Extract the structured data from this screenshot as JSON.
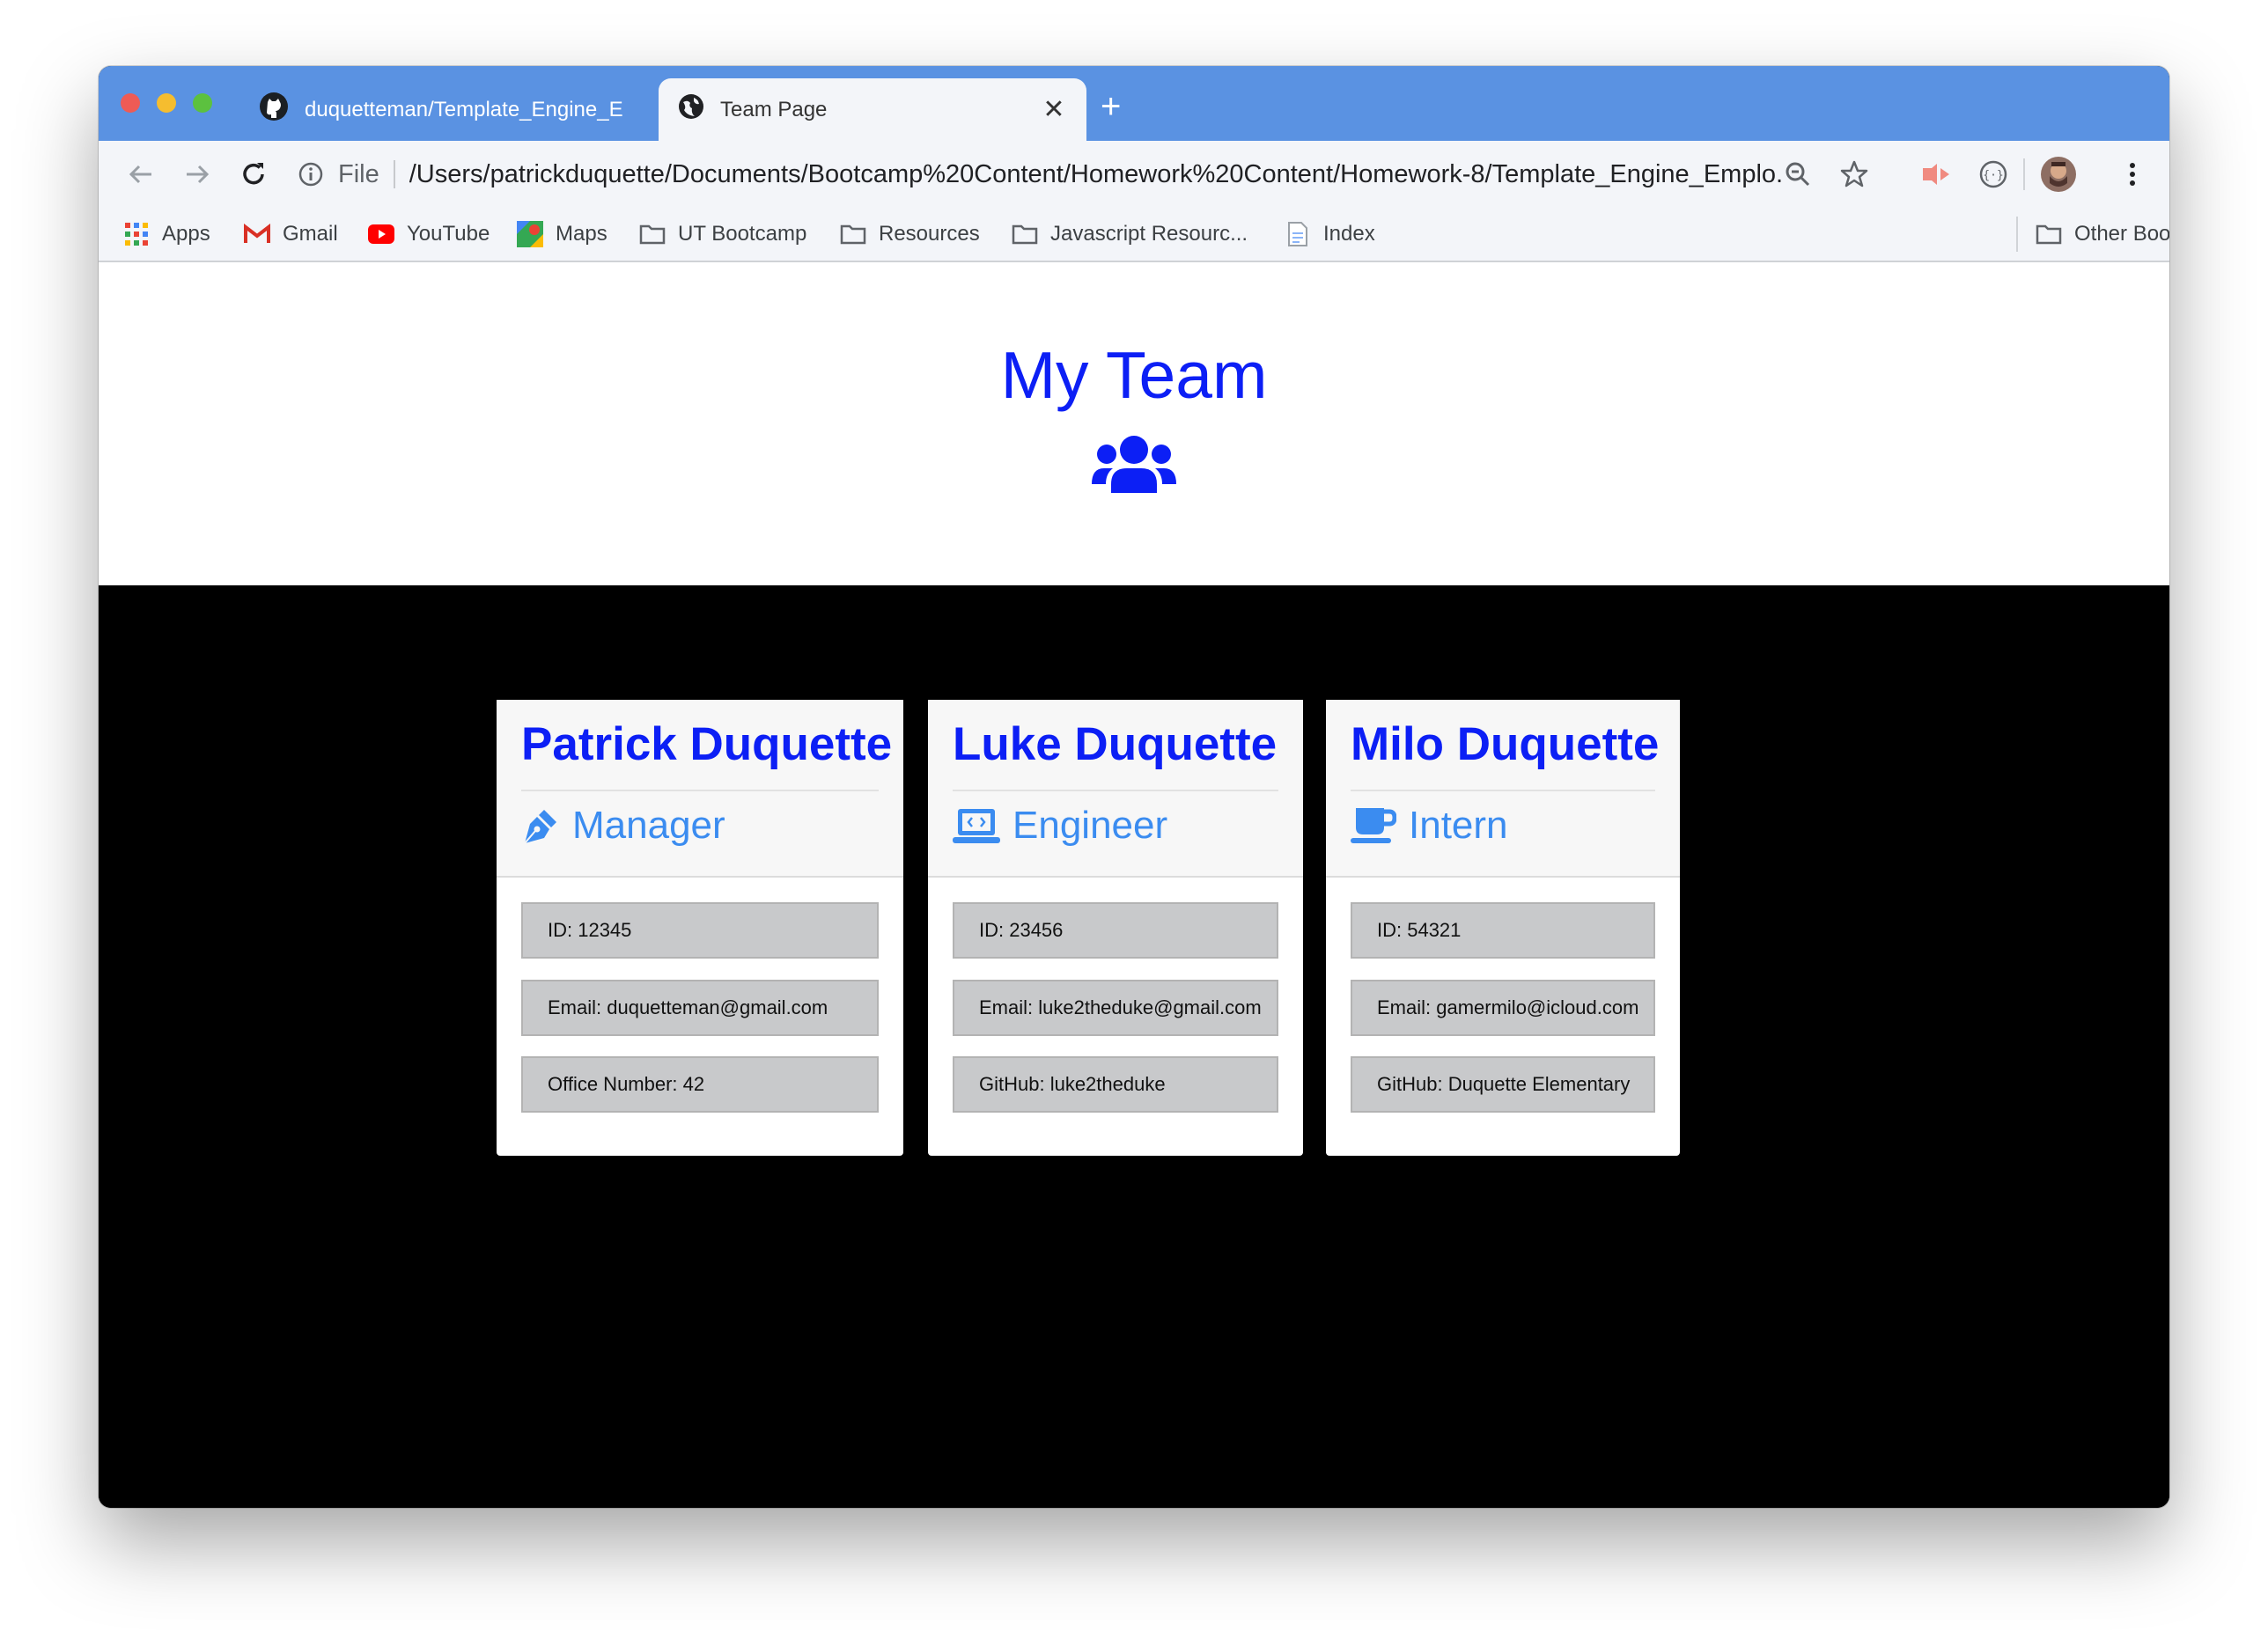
{
  "browser": {
    "tabs": [
      {
        "title": "duquetteman/Template_Engine_E",
        "close": "✕"
      },
      {
        "title": "Team Page",
        "close": "✕"
      }
    ],
    "new_tab": "+",
    "omnibox": {
      "scheme_label": "File",
      "url": "/Users/patrickduquette/Documents/Bootcamp%20Content/Homework%20Content/Homework-8/Template_Engine_Emplo..."
    },
    "bookmarks": [
      "Apps",
      "Gmail",
      "YouTube",
      "Maps",
      "UT Bootcamp",
      "Resources",
      "Javascript Resourc...",
      "Index"
    ],
    "other_bookmarks": "Other Bookmarks"
  },
  "page": {
    "title": "My Team",
    "accent_color": "#0c1ff5",
    "role_color": "#3b8cf0",
    "employees": [
      {
        "name": "Patrick Duquette",
        "role": "Manager",
        "role_icon": "pen-nib-icon",
        "id": "ID: 12345",
        "email": "Email: duquetteman@gmail.com",
        "extra": "Office Number: 42"
      },
      {
        "name": "Luke Duquette",
        "role": "Engineer",
        "role_icon": "laptop-code-icon",
        "id": "ID: 23456",
        "email": "Email: luke2theduke@gmail.com",
        "extra": "GitHub: luke2theduke"
      },
      {
        "name": "Milo Duquette",
        "role": "Intern",
        "role_icon": "mug-icon",
        "id": "ID: 54321",
        "email": "Email: gamermilo@icloud.com",
        "extra": "GitHub: Duquette Elementary"
      }
    ]
  }
}
